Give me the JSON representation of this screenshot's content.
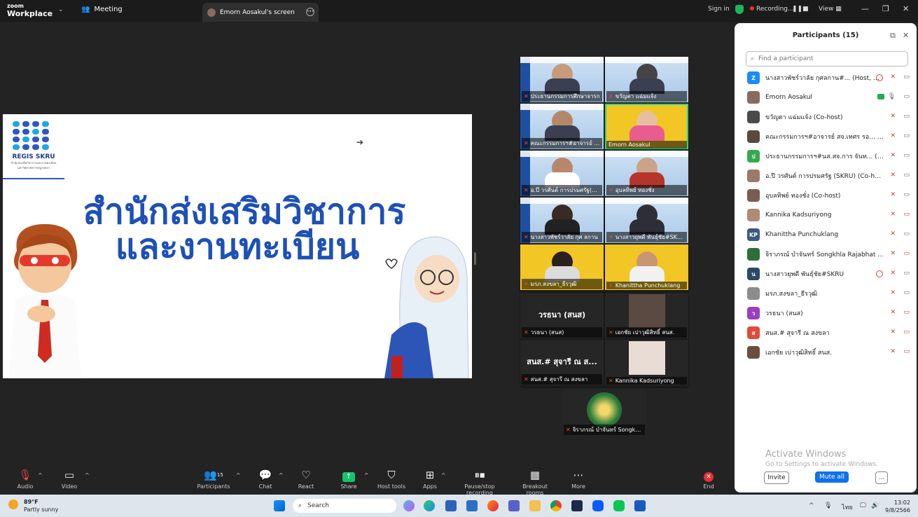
{
  "topbar": {
    "brand_small": "zoom",
    "brand": "Workplace",
    "meeting": "Meeting",
    "screen_tab": "Emorn Aosakul's screen",
    "signin": "Sign in",
    "recording": "Recording...",
    "view": "View"
  },
  "slide": {
    "logo_text": "REGIS SKRU",
    "logo_sub": "สำนักส่งเสริมวิชาการและงานทะเบียน มหาวิทยาลัยราชภัฏสงขลา",
    "title_line1": "สำนักส่งเสริมวิชาการ",
    "title_line2": "และงานทะเบียน"
  },
  "gallery": {
    "tiles": [
      {
        "name": "ประธานกรรมการศึกษาจารก"
      },
      {
        "name": "ขวัญตา แฉ่มแจ้ง"
      },
      {
        "name": "คณะกรรมการฯ#อาจารย์ สจ.เทศร"
      },
      {
        "name": "Emorn Aosakul"
      },
      {
        "name": "อ.ปี วรศันต์ การปรมศรัฐ(SKR"
      },
      {
        "name": "อุบลทิพย์ ทองชั่ง"
      },
      {
        "name": "นางสาวพัชร์วาลัย กุศ ลกาน"
      },
      {
        "name": "นางสาวยุพดี พันธุ์ชัย#SKRU"
      },
      {
        "name": "มรภ.สงขลา_ธีรวุฒิ"
      },
      {
        "name": "Khanittha Punchuklang"
      },
      {
        "name": "วรธนา (สนส)",
        "big": "วรธนา (สนส)"
      },
      {
        "name": "เอกชัย เบ่าวุฒิสิทธิ์ สนส."
      },
      {
        "name": "สนส.# สุจารี ณ สงขลา",
        "big": "สนส.# สุจารี ณ ส..."
      },
      {
        "name": "Kannika Kadsuriyong"
      },
      {
        "name": "จิราภรณ์ บำจันทร์ Songkhl..."
      }
    ]
  },
  "participants": {
    "title": "Participants (15)",
    "search_placeholder": "Find a participant",
    "list": [
      {
        "initial": "Z",
        "color": "#1a8cff",
        "name": "นางสาวพัชร์วาลัย กุศลกาน#... (Host, me)"
      },
      {
        "initial": "",
        "color": "#8a6b5c",
        "name": "Emorn Aosakul"
      },
      {
        "initial": "",
        "color": "#4a4a4a",
        "name": "ขวัญตา แฉ่มแจ้ง (Co-host)"
      },
      {
        "initial": "",
        "color": "#5b4a3c",
        "name": "คณะกรรมการฯ#อาจารย์ สจ.เทศร รอ... (Co-host)"
      },
      {
        "initial": "ป",
        "color": "#35a852",
        "name": "ประธานกรรมการฯ#นส.สจ.การ จันท... (Co-host)"
      },
      {
        "initial": "",
        "color": "#9a7a6a",
        "name": "อ.ปี วรศันต์ การปรมศรัฐ (SKRU) (Co-host)"
      },
      {
        "initial": "",
        "color": "#7a5d50",
        "name": "อุบลทิพย์ ทองชั่ง (Co-host)"
      },
      {
        "initial": "",
        "color": "#b08a74",
        "name": "Kannika Kadsuriyong"
      },
      {
        "initial": "KP",
        "color": "#3d5a80",
        "name": "Khanittha Punchuklang"
      },
      {
        "initial": "",
        "color": "#2f6e3a",
        "name": "จิราภรณ์ บำจันทร์ Songkhla Rajabhat Unive..."
      },
      {
        "initial": "น",
        "color": "#2c4a66",
        "name": "นางสาวยุพดี พันธุ์ชัย#SKRU"
      },
      {
        "initial": "",
        "color": "#8c8c8c",
        "name": "มรภ.สงขลา_ธีรวุฒิ"
      },
      {
        "initial": "ว",
        "color": "#9b3fbf",
        "name": "วรธนา (สนส)"
      },
      {
        "initial": "ส",
        "color": "#e04a3a",
        "name": "สนส.# สุจารี ณ สงขลา"
      },
      {
        "initial": "",
        "color": "#6a4e3e",
        "name": "เอกชัย เบ่าวุฒิสิทธิ์ สนส."
      }
    ],
    "activate_title": "Activate Windows",
    "activate_sub": "Go to Settings to activate Windows.",
    "invite": "Invite",
    "mute_all": "Mute all",
    "more": "..."
  },
  "toolbar": {
    "audio": "Audio",
    "video": "Video",
    "participants": "Participants",
    "participants_count": "15",
    "chat": "Chat",
    "react": "React",
    "share": "Share",
    "host_tools": "Host tools",
    "apps": "Apps",
    "pause_rec": "Pause/stop recording",
    "breakout": "Breakout rooms",
    "more": "More",
    "end": "End"
  },
  "taskbar": {
    "temp": "89°F",
    "weather": "Partly sunny",
    "search": "Search",
    "lang": "ไทย",
    "time": "13:02",
    "date": "9/8/2566"
  }
}
